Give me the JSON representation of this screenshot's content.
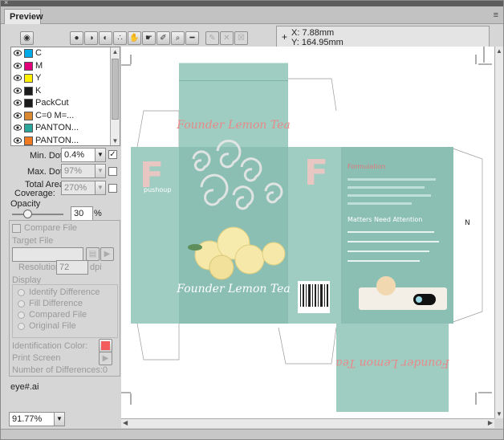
{
  "window": {
    "title": "Preview",
    "close_glyph": "×",
    "menu_glyph": "≡"
  },
  "toolbar": {
    "buttons": [
      {
        "name": "view-toggle-button",
        "glyph": "◉"
      },
      {
        "name": "overprint-preview-icon",
        "glyph": "●"
      },
      {
        "name": "separation-preview-icon",
        "glyph": "◑"
      },
      {
        "name": "halftone-icon",
        "glyph": "◐"
      },
      {
        "name": "resolution-icon",
        "glyph": "∴"
      },
      {
        "name": "hand-tool-icon",
        "glyph": "✋"
      },
      {
        "name": "grab-tool-icon",
        "glyph": "☛"
      },
      {
        "name": "eyedropper-icon",
        "glyph": "✐"
      },
      {
        "name": "zoom-icon",
        "glyph": "⌕"
      },
      {
        "name": "ruler-icon",
        "glyph": "━"
      },
      {
        "name": "pencil-icon",
        "glyph": "✎"
      },
      {
        "name": "delete-x-icon",
        "glyph": "✕"
      },
      {
        "name": "trash-icon",
        "glyph": "☒"
      }
    ]
  },
  "coordinates": {
    "x": "X:  7.88mm",
    "y": "Y:  164.95mm",
    "plus": "+"
  },
  "separations": [
    {
      "name": "C",
      "color": "#00a9e8"
    },
    {
      "name": "M",
      "color": "#e2007a"
    },
    {
      "name": "Y",
      "color": "#ffef00"
    },
    {
      "name": "K",
      "color": "#1a1a1a"
    },
    {
      "name": "PackCut",
      "color": "#1a1a1a"
    },
    {
      "name": "C=0 M=...",
      "color": "#d98a30"
    },
    {
      "name": "PANTON...",
      "color": "#2aa79a"
    },
    {
      "name": "PANTON...",
      "color": "#f07a1f"
    }
  ],
  "settings": {
    "min_dot_label": "Min. Dot:",
    "min_dot_value": "0.4%",
    "max_dot_label": "Max. Dot:",
    "max_dot_value": "97%",
    "tac_label_1": "Total Area",
    "tac_label_2": "Coverage:",
    "tac_value": "270%",
    "opacity_label": "Opacity",
    "opacity_value": "30",
    "opacity_unit": "%",
    "opacity_level": 0.3
  },
  "compare": {
    "compare_file_label": "Compare File",
    "target_file_label": "Target File",
    "target_file_value": "",
    "resolution_label": "Resolution:",
    "resolution_value": "72",
    "resolution_unit": "dpi",
    "display_label": "Display",
    "display_options": [
      "Identify Difference",
      "Fill Difference",
      "Compared File",
      "Original File"
    ],
    "identification_color_label": "Identification Color:",
    "identification_color": "#f25c5c",
    "print_screen_label": "Print Screen",
    "num_diff_label": "Number of Differences:0"
  },
  "filename": "eye#.ai",
  "zoom": "91.77%",
  "artwork": {
    "product_title": "Founder Lemon Tea",
    "brand_letter": "F",
    "brand_small": "pushoup",
    "formulation_heading": "Formulation",
    "attention_heading": "Matters Need Attention",
    "side_label": "N",
    "package_color": "#9fcdc2"
  }
}
